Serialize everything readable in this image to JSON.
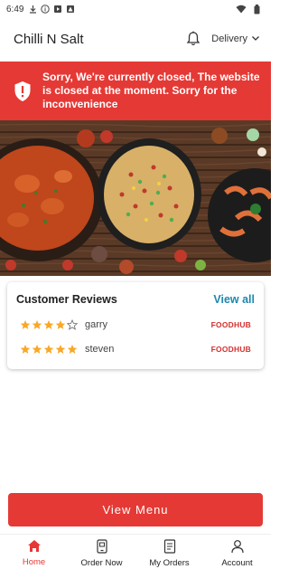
{
  "status_bar": {
    "time": "6:49",
    "icons": [
      "download-icon",
      "info-icon",
      "media-icon",
      "warning-icon"
    ],
    "right_icons": [
      "wifi-icon",
      "battery-icon"
    ]
  },
  "app_bar": {
    "title": "Chilli N Salt",
    "delivery_label": "Delivery",
    "bell_icon": "bell-icon"
  },
  "banner": {
    "message": "Sorry, We're currently closed, The website is closed at the moment. Sorry for the inconvenience",
    "color": "#e53935",
    "icon": "shield-alert-icon"
  },
  "hero": {
    "alt": "food dishes"
  },
  "reviews": {
    "heading": "Customer Reviews",
    "view_all": "View all",
    "items": [
      {
        "name": "garry",
        "rating": 4,
        "source": "FOODHUB"
      },
      {
        "name": "steven",
        "rating": 5,
        "source": "FOODHUB"
      }
    ]
  },
  "view_menu_label": "View Menu",
  "nav": {
    "items": [
      {
        "label": "Home",
        "icon": "home-icon",
        "active": true
      },
      {
        "label": "Order Now",
        "icon": "phone-order-icon",
        "active": false
      },
      {
        "label": "My Orders",
        "icon": "receipt-icon",
        "active": false
      },
      {
        "label": "Account",
        "icon": "account-icon",
        "active": false
      }
    ]
  },
  "colors": {
    "accent": "#e53935",
    "link": "#1e88b0",
    "star": "#f9a825"
  }
}
